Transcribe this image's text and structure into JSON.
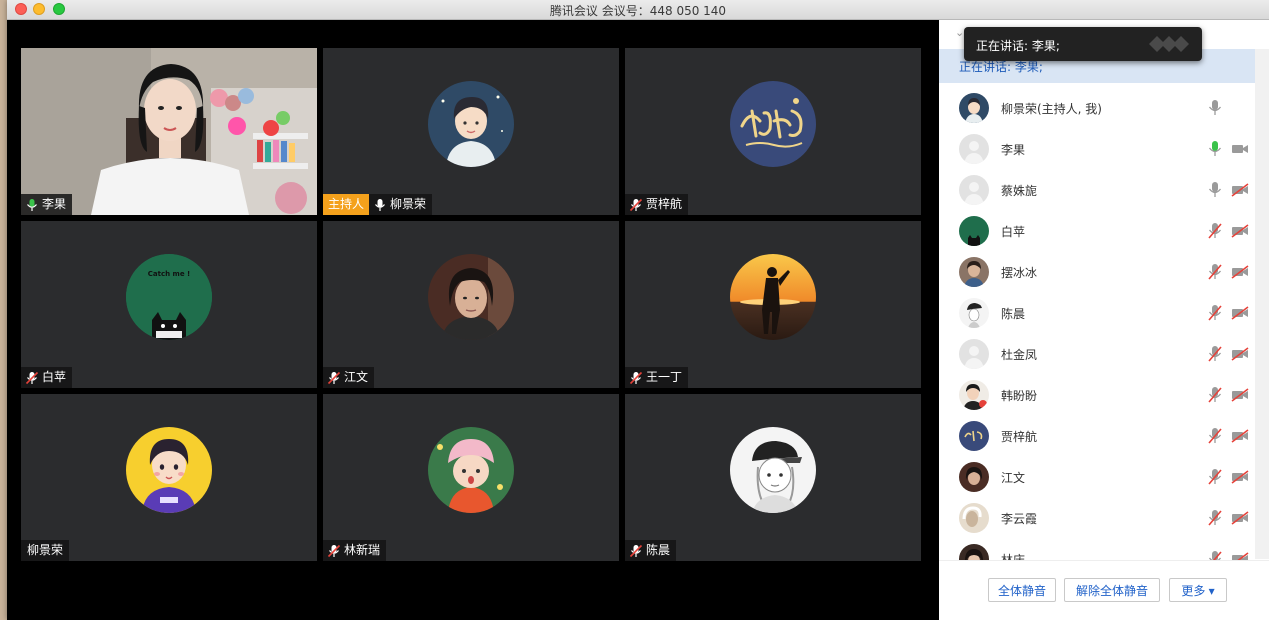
{
  "window": {
    "title": "腾讯会议 会议号：448 050 140"
  },
  "gallery": {
    "tiles": [
      {
        "name": "李果",
        "mic": "on"
      },
      {
        "name": "柳景荣",
        "host_tag": "主持人",
        "mic": "open"
      },
      {
        "name": "贾梓航",
        "mic": "muted"
      },
      {
        "name": "白苹",
        "mic": "muted",
        "avatar_text": "Catch me !"
      },
      {
        "name": "江文",
        "mic": "muted"
      },
      {
        "name": "王一丁",
        "mic": "muted"
      },
      {
        "name": "柳景荣",
        "mic": "none"
      },
      {
        "name": "林新瑞",
        "mic": "muted"
      },
      {
        "name": "陈晨",
        "mic": "muted"
      }
    ]
  },
  "panel": {
    "speaking_text": "正在讲话: 李果;",
    "tooltip_text": "正在讲话: 李果;",
    "participants": [
      {
        "name": "柳景荣(主持人, 我)",
        "mic": "open",
        "cam": "none"
      },
      {
        "name": "李果",
        "mic": "active",
        "cam": "on"
      },
      {
        "name": "蔡姝旎",
        "mic": "open",
        "cam": "off"
      },
      {
        "name": "白苹",
        "mic": "muted",
        "cam": "off"
      },
      {
        "name": "摆冰冰",
        "mic": "muted",
        "cam": "off"
      },
      {
        "name": "陈晨",
        "mic": "muted",
        "cam": "off"
      },
      {
        "name": "杜金凤",
        "mic": "muted",
        "cam": "off"
      },
      {
        "name": "韩盼盼",
        "mic": "muted",
        "cam": "off"
      },
      {
        "name": "贾梓航",
        "mic": "muted",
        "cam": "off"
      },
      {
        "name": "江文",
        "mic": "muted",
        "cam": "off"
      },
      {
        "name": "李云霞",
        "mic": "muted",
        "cam": "off"
      },
      {
        "name": "林庆",
        "mic": "muted",
        "cam": "off"
      }
    ],
    "buttons": {
      "mute_all": "全体静音",
      "unmute_all": "解除全体静音",
      "more": "更多 ▾"
    }
  },
  "colors": {
    "host_tag": "#f4a11c",
    "mic_active": "#3ac24a",
    "muted_red": "#e5423a",
    "speaking_bg": "#d9e5f4"
  }
}
